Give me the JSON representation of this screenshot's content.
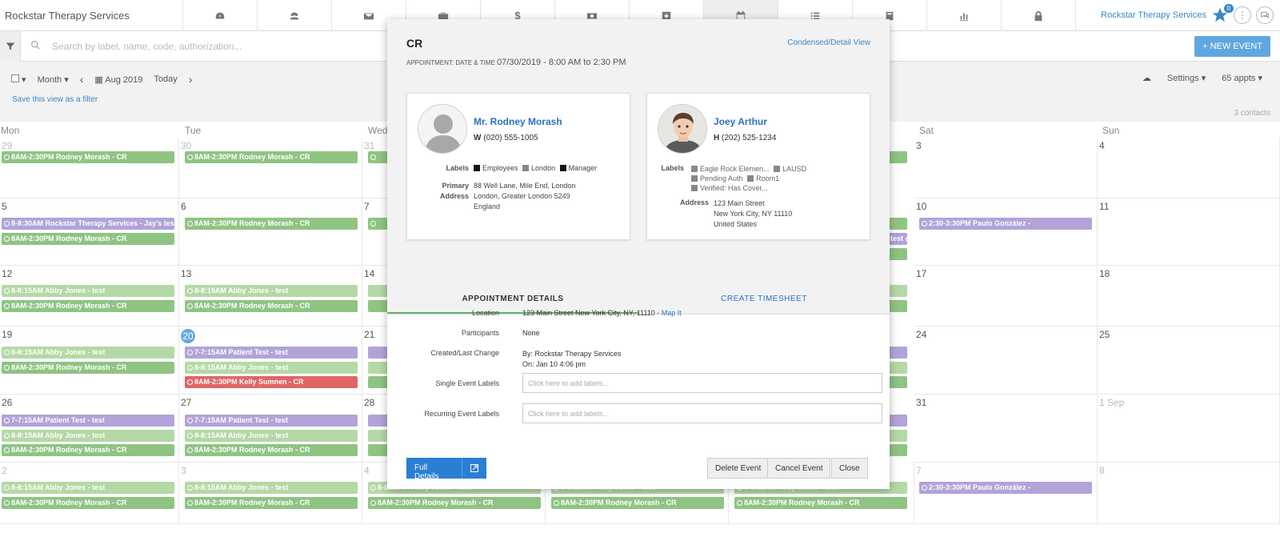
{
  "app": {
    "title": "Rockstar Therapy Services",
    "account": "Rockstar Therapy Services",
    "notif_count": "0"
  },
  "nav_icons": [
    "dashboard-icon",
    "clients-icon",
    "mail-icon",
    "briefcase-icon",
    "billing-icon",
    "payments-icon",
    "medical-icon",
    "calendar-icon",
    "tasks-icon",
    "notes-icon",
    "reports-icon",
    "lock-icon"
  ],
  "search": {
    "placeholder": "Search by label, name, code, authorization..."
  },
  "new_event_label": "+ NEW EVENT",
  "toolbar": {
    "view": "Month",
    "date": "Aug 2019",
    "today": "Today",
    "save_filter": "Save this view as a filter",
    "settings": "Settings",
    "appts": "65 appts",
    "contacts": "3 contacts"
  },
  "calendar": {
    "days": [
      "Mon",
      "Tue",
      "Wed",
      "Thu",
      "Fri",
      "Sat",
      "Sun"
    ],
    "weeks": [
      [
        "29",
        "30",
        "31",
        "",
        "",
        "3",
        "4"
      ],
      [
        "5",
        "6",
        "7",
        "",
        "",
        "10",
        "11"
      ],
      [
        "12",
        "13",
        "14",
        "",
        "",
        "17",
        "18"
      ],
      [
        "19",
        "20",
        "21",
        "",
        "",
        "24",
        "25"
      ],
      [
        "26",
        "27",
        "28",
        "",
        "",
        "31",
        "1 Sep"
      ],
      [
        "2",
        "3",
        "4",
        "",
        "",
        "7",
        "8"
      ]
    ],
    "events": {
      "rm": "8AM-2:30PM Rodney Morash - CR",
      "rts": "8-8:30AM Rockstar Therapy Services - Jay's test a",
      "aj": "8-8:15AM Abby Jones - test",
      "pt": "7-7:15AM Patient Test - test",
      "ks": "8AM-2:30PM Kelly Sumnen - CR",
      "pg": "2:30-3:30PM Paulo González -",
      "trunc_a": "test a"
    }
  },
  "modal": {
    "title": "CR",
    "toggle": "Condensed/Detail View",
    "date_label": "APPOINTMENT: DATE & TIME",
    "date_value": "07/30/2019 - 8:00 AM to 2:30 PM",
    "contact1": {
      "name": "Mr. Rodney Morash",
      "phone_type": "W",
      "phone": "(020) 555-1005",
      "labels_key": "Labels",
      "labels": [
        "Employees",
        "London",
        "Manager"
      ],
      "address_key_1": "Primary",
      "address_key_2": "Address",
      "address": [
        "88 Well Lane, Mile End, London",
        "London, Greater London 5249",
        "England"
      ]
    },
    "contact2": {
      "name": "Joey Arthur",
      "phone_type": "H",
      "phone": "(202) 525-1234",
      "labels_key": "Labels",
      "labels": [
        "Eagle Rock Elemen...",
        "LAUSD",
        "Pending Auth",
        "Room1",
        "Verified: Has Cover..."
      ],
      "address_key": "Address",
      "address": [
        "123 Main Street",
        "New York City, NY 11110",
        "United States"
      ]
    },
    "tabs": {
      "details": "APPOINTMENT DETAILS",
      "timesheet": "CREATE TIMESHEET"
    },
    "details": {
      "location_key": "Location",
      "location": "123 Main Street New York City, NY, 11110 -",
      "map_it": "Map It",
      "participants_key": "Participants",
      "participants": "None",
      "created_key": "Created/Last Change",
      "created_by": "By: Rockstar Therapy Services",
      "created_on": "On: Jan 10 4:06 pm",
      "single_key": "Single Event Labels",
      "recurring_key": "Recurring Event Labels",
      "label_placeholder": "Click here to add labels..."
    },
    "buttons": {
      "full": "Full Details",
      "delete": "Delete Event",
      "cancel": "Cancel Event",
      "close": "Close"
    }
  }
}
